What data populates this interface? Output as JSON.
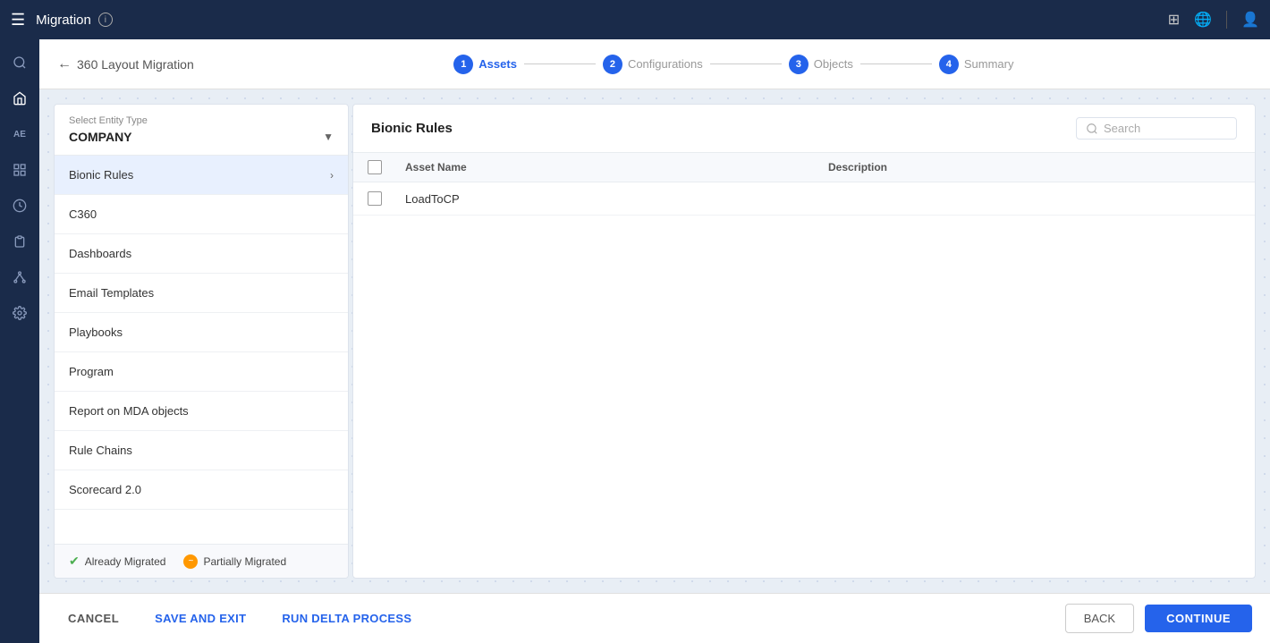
{
  "topbar": {
    "title": "Migration",
    "menu_icon": "☰",
    "info_icon": "i"
  },
  "steps": [
    {
      "num": "1",
      "label": "Assets",
      "active": true
    },
    {
      "num": "2",
      "label": "Configurations",
      "active": false
    },
    {
      "num": "3",
      "label": "Objects",
      "active": false
    },
    {
      "num": "4",
      "label": "Summary",
      "active": false
    }
  ],
  "breadcrumb": {
    "back_label": "360 Layout Migration"
  },
  "left_panel": {
    "entity_label": "Select Entity Type",
    "entity_value": "COMPANY",
    "menu_items": [
      {
        "label": "Bionic Rules",
        "has_chevron": true,
        "selected": true
      },
      {
        "label": "C360",
        "has_chevron": false,
        "selected": false
      },
      {
        "label": "Dashboards",
        "has_chevron": false,
        "selected": false
      },
      {
        "label": "Email Templates",
        "has_chevron": false,
        "selected": false
      },
      {
        "label": "Playbooks",
        "has_chevron": false,
        "selected": false
      },
      {
        "label": "Program",
        "has_chevron": false,
        "selected": false
      },
      {
        "label": "Report on MDA objects",
        "has_chevron": false,
        "selected": false
      },
      {
        "label": "Rule Chains",
        "has_chevron": false,
        "selected": false
      },
      {
        "label": "Scorecard 2.0",
        "has_chevron": false,
        "selected": false
      }
    ]
  },
  "right_panel": {
    "title": "Bionic Rules",
    "search_placeholder": "Search",
    "columns": [
      {
        "label": "Asset Name"
      },
      {
        "label": "Description"
      }
    ],
    "rows": [
      {
        "name": "LoadToCP",
        "description": ""
      }
    ]
  },
  "legend": {
    "already_migrated": "Already Migrated",
    "partially_migrated": "Partially Migrated"
  },
  "footer": {
    "cancel": "CANCEL",
    "save_and_exit": "SAVE AND EXIT",
    "run_delta": "RUN DELTA PROCESS",
    "back": "BACK",
    "continue": "CONTINUE"
  },
  "sidebar_icons": [
    {
      "name": "search",
      "symbol": "🔍"
    },
    {
      "name": "home",
      "symbol": "⌂"
    },
    {
      "name": "ae",
      "symbol": "AE"
    },
    {
      "name": "list",
      "symbol": "≡"
    },
    {
      "name": "clock",
      "symbol": "⏱"
    },
    {
      "name": "clipboard",
      "symbol": "📋"
    },
    {
      "name": "nodes",
      "symbol": "⬡"
    },
    {
      "name": "gear",
      "symbol": "⚙"
    }
  ]
}
